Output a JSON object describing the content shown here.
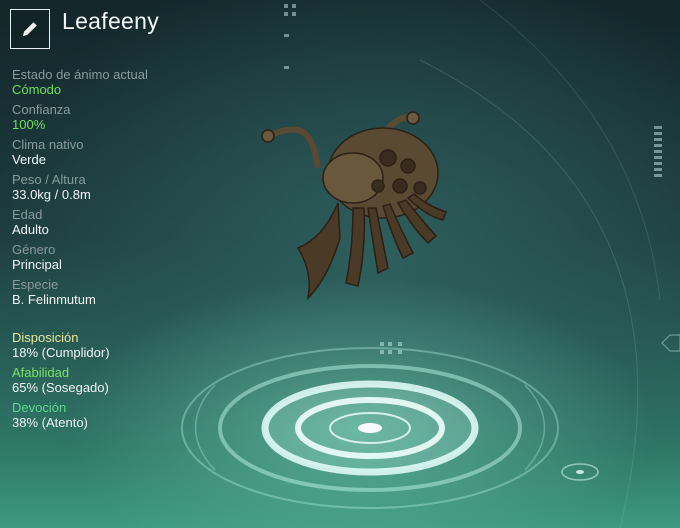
{
  "header": {
    "edit_icon": "pencil-icon",
    "creature_name": "Leafeeny"
  },
  "stats": [
    {
      "label": "Estado de ánimo actual",
      "value": "Cómodo",
      "highlight": true
    },
    {
      "label": "Confianza",
      "value": "100%",
      "highlight": true
    },
    {
      "label": "Clima nativo",
      "value": "Verde",
      "highlight": false
    },
    {
      "label": "Peso / Altura",
      "value": "33.0kg / 0.8m",
      "highlight": false
    },
    {
      "label": "Edad",
      "value": "Adulto",
      "highlight": false
    },
    {
      "label": "Género",
      "value": "Principal",
      "highlight": false
    },
    {
      "label": "Especie",
      "value": "B. Felinmutum",
      "highlight": false
    }
  ],
  "traits": [
    {
      "label": "Disposición",
      "value": "18% (Cumplidor)",
      "color": "#e9e69a"
    },
    {
      "label": "Afabilidad",
      "value": "65% (Sosegado)",
      "color": "#7be16b"
    },
    {
      "label": "Devoción",
      "value": "38% (Atento)",
      "color": "#5fd68a"
    }
  ],
  "colors": {
    "accent_green": "#6fe05c",
    "label_gray": "#8a9b9b"
  }
}
